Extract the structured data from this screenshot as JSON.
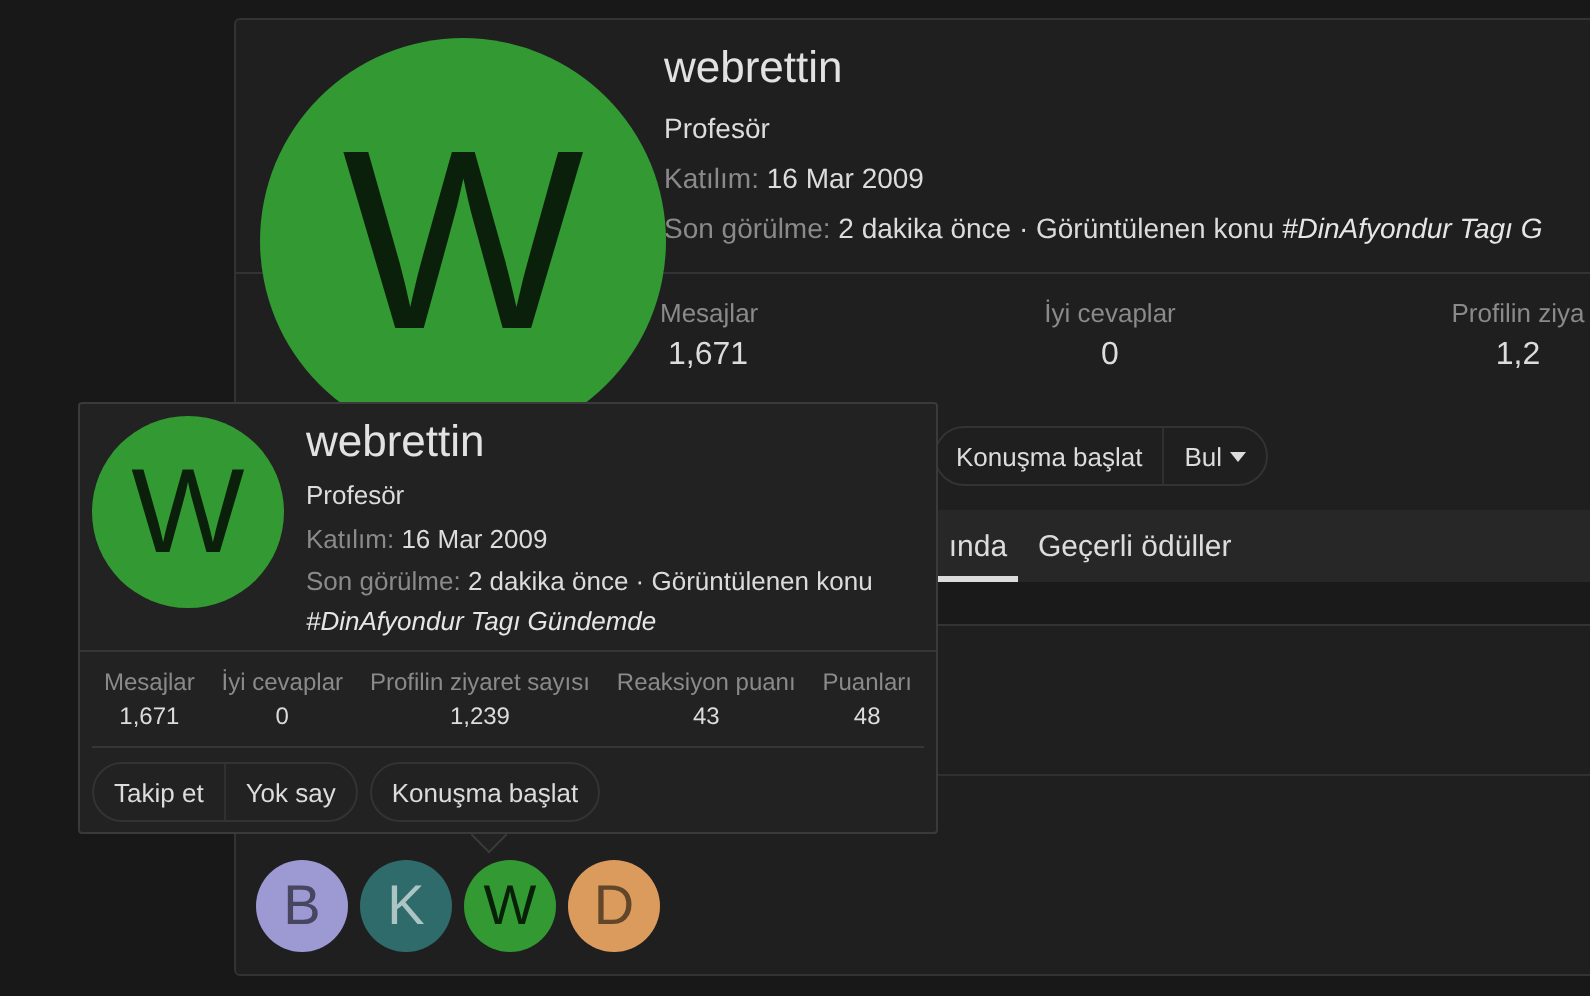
{
  "profile": {
    "avatar_letter": "W",
    "name": "webrettin",
    "title": "Profesör",
    "joined_label": "Katılım:",
    "joined": "16 Mar 2009",
    "last_seen_label": "Son görülme:",
    "last_seen": "2 dakika önce · Görüntülenen konu",
    "last_seen_link": "#DinAfyondur Tagı G",
    "stats": [
      {
        "label": "Mesajlar",
        "value": "1,671"
      },
      {
        "label": "İyi cevaplar",
        "value": "0"
      },
      {
        "label": "Profilin ziya",
        "value": "1,2"
      }
    ],
    "buttons": [
      {
        "label": "Konuşma başlat",
        "kind": "button"
      },
      {
        "label": "Bul",
        "kind": "menu"
      }
    ],
    "tabs": [
      {
        "label": "ında",
        "selected": true
      },
      {
        "label": "Geçerli ödüller",
        "selected": false
      }
    ],
    "participants": [
      {
        "letter": "B",
        "color": "#9d99d3"
      },
      {
        "letter": "K",
        "color": "#2f6b6b"
      },
      {
        "letter": "W",
        "color": "#339933"
      },
      {
        "letter": "D",
        "color": "#da9b5d"
      }
    ]
  },
  "popup": {
    "avatar_letter": "W",
    "name": "webrettin",
    "title": "Profesör",
    "joined_label": "Katılım:",
    "joined": "16 Mar 2009",
    "last_seen_label": "Son görülme:",
    "last_seen": "2 dakika önce · Görüntülenen konu",
    "last_seen_link": "#DinAfyondur Tagı Gündemde",
    "stats": [
      {
        "label": "Mesajlar",
        "value": "1,671"
      },
      {
        "label": "İyi cevaplar",
        "value": "0"
      },
      {
        "label": "Profilin ziyaret sayısı",
        "value": "1,239"
      },
      {
        "label": "Reaksiyon puanı",
        "value": "43"
      },
      {
        "label": "Puanları",
        "value": "48"
      }
    ],
    "button_groups": [
      {
        "buttons": [
          "Takip et",
          "Yok say"
        ]
      },
      {
        "buttons": [
          "Konuşma başlat"
        ]
      }
    ]
  }
}
